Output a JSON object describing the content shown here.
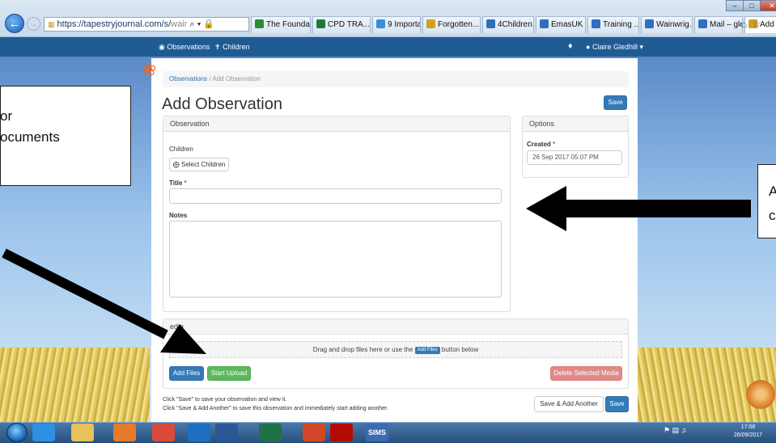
{
  "browser": {
    "address_scheme_host": "https://tapestryjournal.com/s/",
    "address_rest": "wair",
    "tabs": [
      {
        "label": "The Foundati...",
        "icon_color": "#2d8a3a"
      },
      {
        "label": "CPD TRA...",
        "icon_color": "#1f7a3a"
      },
      {
        "label": "9 Importa...",
        "icon_color": "#3b8fd6"
      },
      {
        "label": "Forgotten...",
        "icon_color": "#d0a021"
      },
      {
        "label": "4Children...",
        "icon_color": "#2f6fc0"
      },
      {
        "label": "EmasUK | ...",
        "icon_color": "#2f6fc0"
      },
      {
        "label": "Training ...",
        "icon_color": "#2f6fc0"
      },
      {
        "label": "Wainwrig...",
        "icon_color": "#2f6fc0"
      },
      {
        "label": "Mail – gle...",
        "icon_color": "#2f6fc0"
      },
      {
        "label": "Add O...",
        "icon_color": "#d0a021"
      }
    ]
  },
  "nav": {
    "observations": "Observations",
    "children": "Children",
    "user": "Claire Gledhill"
  },
  "breadcrumb": {
    "first": "Observations",
    "sep": "/",
    "current": "Add Observation"
  },
  "page_title": "Add Observation",
  "buttons": {
    "save": "Save",
    "select_children": "Select Children",
    "add_files": "Add Files",
    "start_upload": "Start Upload",
    "delete_selected": "Delete Selected Media",
    "save_add_another": "Save & Add Another"
  },
  "observation": {
    "heading": "Observation",
    "children_label": "Children",
    "title_label": "Title",
    "notes_label": "Notes",
    "title_value": "",
    "notes_value": ""
  },
  "options": {
    "heading": "Options",
    "created_label": "Created",
    "created_value": "26 Sep 2017 05:07 PM"
  },
  "media": {
    "heading": "edia",
    "drop_before": "Drag and drop files here or use the",
    "drop_tag": "Add Files",
    "drop_after": "button below"
  },
  "help": {
    "line1": "Click \"Save\" to save your observation and view it.",
    "line2": "Click \"Save & Add Another\" to save this observation and immediately start adding another."
  },
  "callouts": {
    "left": "or\nocuments",
    "right": "A\nc"
  },
  "taskbar": {
    "clock_time": "17:08",
    "clock_date": "26/09/2017",
    "sims": "SIMS"
  },
  "colors": {
    "nav": "#1f5b93",
    "primary": "#337ab7",
    "success": "#5cb85c",
    "danger": "#e08a87"
  }
}
